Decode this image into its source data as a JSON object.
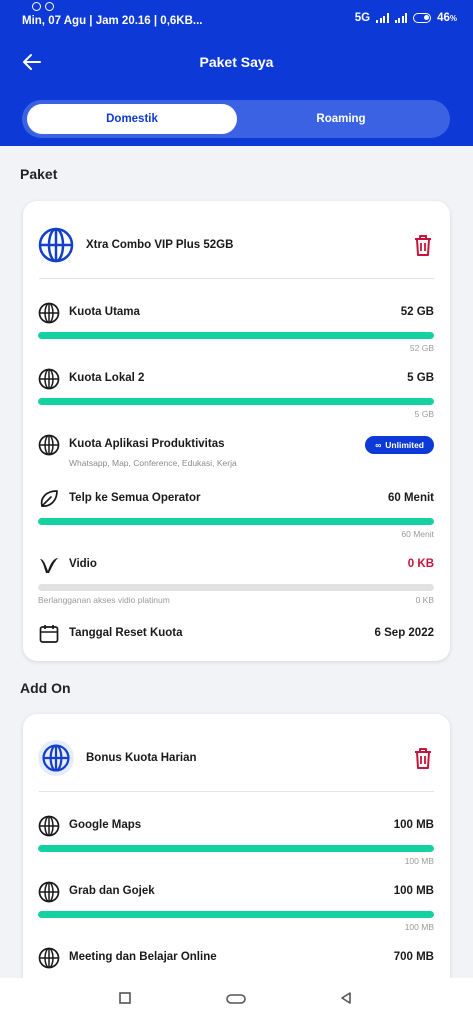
{
  "status_bar": {
    "left": "Min, 07 Agu | Jam 20.16 | 0,6KB...",
    "network": "5G",
    "battery": "46"
  },
  "header": {
    "title": "Paket Saya",
    "tabs": [
      {
        "label": "Domestik",
        "active": true
      },
      {
        "label": "Roaming",
        "active": false
      }
    ]
  },
  "paket": {
    "section_title": "Paket",
    "name": "Xtra Combo VIP Plus 52GB",
    "items": [
      {
        "icon": "globe-icon",
        "label": "Kuota Utama",
        "value": "52 GB",
        "bar_note": "52 GB",
        "remaining_fraction": 1.0
      },
      {
        "icon": "globe-icon",
        "label": "Kuota Lokal 2",
        "value": "5 GB",
        "bar_note": "5 GB",
        "remaining_fraction": 1.0
      },
      {
        "icon": "globe-icon",
        "label": "Kuota Aplikasi Produktivitas",
        "sub": "Whatsapp, Map, Conference, Edukasi, Kerja",
        "badge": "Unlimited",
        "badge_symbol": "∞"
      },
      {
        "icon": "phone-leaf-icon",
        "label": "Telp ke Semua Operator",
        "value": "60 Menit",
        "bar_note": "60 Menit",
        "remaining_fraction": 1.0
      },
      {
        "icon": "vidio-icon",
        "label": "Vidio",
        "value": "0 KB",
        "bar_note": "0 KB",
        "bar_note_left": "Berlangganan akses vidio platinum",
        "remaining_fraction": 0.0
      },
      {
        "icon": "calendar-icon",
        "label": "Tanggal Reset Kuota",
        "value": "6 Sep 2022"
      }
    ]
  },
  "addon": {
    "section_title": "Add On",
    "name": "Bonus Kuota Harian",
    "items": [
      {
        "icon": "globe-icon",
        "label": "Google Maps",
        "value": "100 MB",
        "bar_note": "100 MB",
        "remaining_fraction": 1.0
      },
      {
        "icon": "globe-icon",
        "label": "Grab dan Gojek",
        "value": "100 MB",
        "bar_note": "100 MB",
        "remaining_fraction": 1.0
      },
      {
        "icon": "globe-icon",
        "label": "Meeting dan Belajar Online",
        "value": "700 MB"
      }
    ]
  },
  "colors": {
    "primary": "#0d3ad6",
    "progress": "#13d1a0",
    "danger": "#c8143c"
  }
}
